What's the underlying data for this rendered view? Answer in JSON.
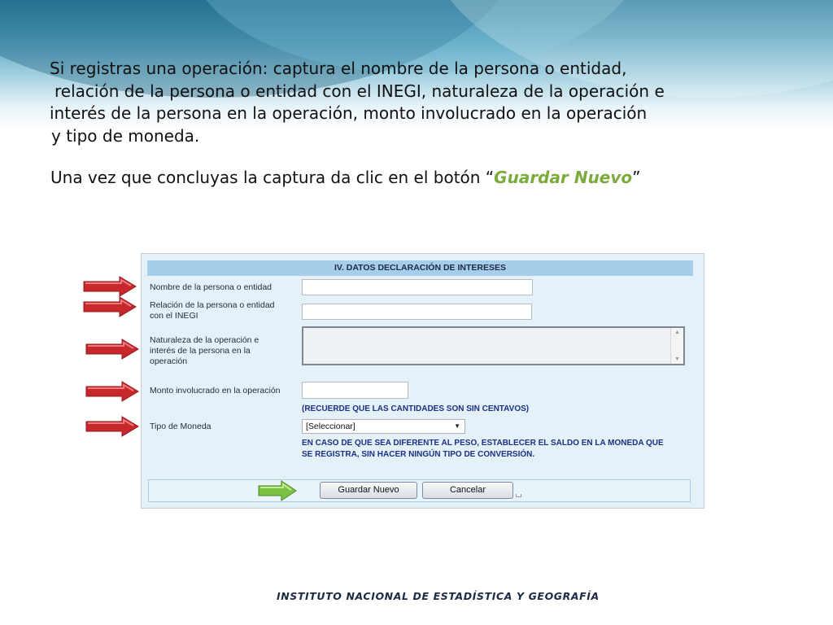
{
  "slide": {
    "intro_lines": [
      "Si registras una operación: captura el nombre de la persona o entidad,",
      "relación de la persona o entidad con el INEGI, naturaleza  de la operación e",
      "interés de la persona en la operación,  monto involucrado en la operación",
      "y tipo de moneda."
    ],
    "instruction_prefix": "Una vez que concluyas la captura da clic en el botón “",
    "instruction_button": "Guardar Nuevo",
    "instruction_suffix": "”",
    "highlight_color": "#7bab3b",
    "footer": "INSTITUTO NACIONAL  DE ESTADÍSTICA Y GEOGRAFÍA"
  },
  "form": {
    "section_title": "IV. DATOS DECLARACIÓN DE INTERESES",
    "fields": {
      "nombre_label": "Nombre de la persona o entidad",
      "nombre_value": "",
      "relacion_label_1": "Relación de la persona o entidad",
      "relacion_label_2": "con el INEGI",
      "relacion_value": "",
      "naturaleza_label_1": "Naturaleza de la operación e",
      "naturaleza_label_2": "interés de la persona en la",
      "naturaleza_label_3": "operación",
      "naturaleza_value": "",
      "monto_label": "Monto involucrado en la operación",
      "monto_value": "",
      "monto_note": "(RECUERDE QUE LAS CANTIDADES SON SIN CENTAVOS)",
      "moneda_label": "Tipo de Moneda",
      "moneda_selected": "[Seleccionar]",
      "moneda_note_1": "EN CASO DE QUE SEA DIFERENTE AL PESO, ESTABLECER EL SALDO EN LA MONEDA QUE",
      "moneda_note_2": "SE REGISTRA, SIN HACER NINGÚN TIPO DE CONVERSIÓN."
    },
    "buttons": {
      "save": "Guardar Nuevo",
      "cancel": "Cancelar"
    },
    "colors": {
      "panel_bg": "#e4f1f8",
      "title_bg": "#a6cde9",
      "note_text": "#1a2f86",
      "red_arrow": "#c8282c",
      "green_arrow": "#7cc242"
    }
  }
}
